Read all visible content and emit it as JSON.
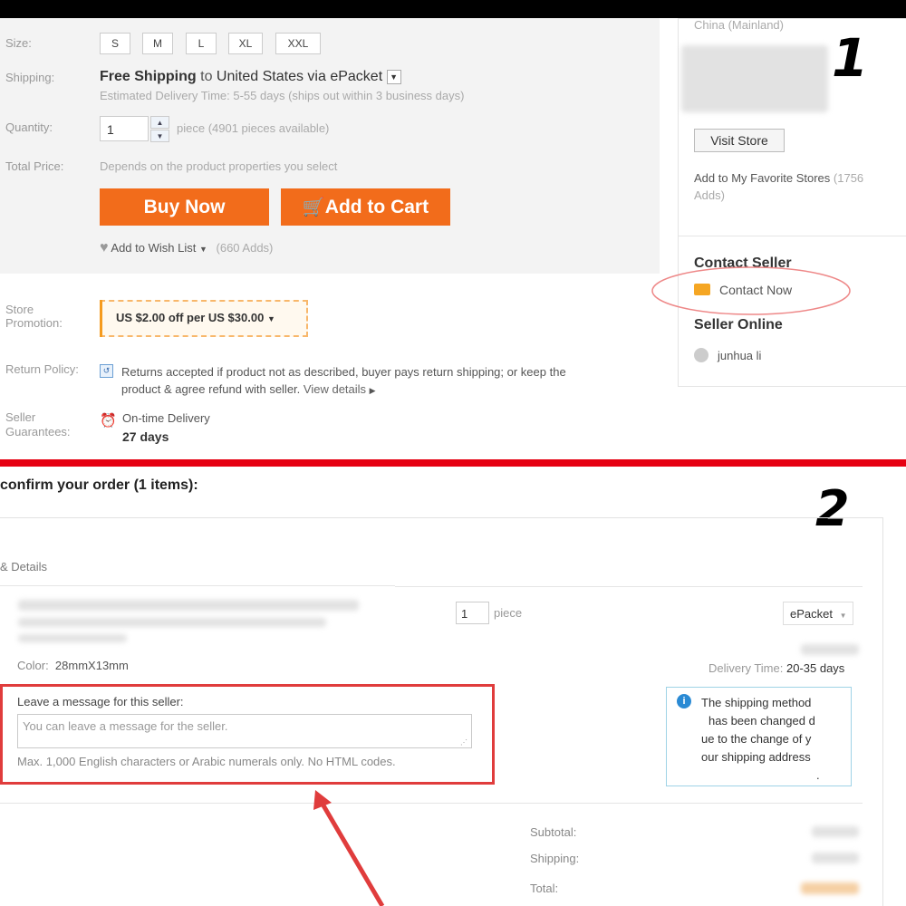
{
  "panel1": {
    "step_number": "1",
    "size": {
      "label": "Size:",
      "options": [
        "S",
        "M",
        "L",
        "XL",
        "XXL"
      ]
    },
    "shipping": {
      "label": "Shipping:",
      "free_text": "Free Shipping",
      "to_text": "to",
      "destination": "United States via ePacket",
      "estimate": "Estimated Delivery Time: 5-55 days (ships out within 3 business days)"
    },
    "quantity": {
      "label": "Quantity:",
      "value": "1",
      "available": "piece (4901 pieces available)"
    },
    "total": {
      "label": "Total Price:",
      "value": "Depends on the product properties you select"
    },
    "buy_now": "Buy Now",
    "add_to_cart": "Add to Cart",
    "wishlist": {
      "label": "Add to Wish List",
      "count": "(660 Adds)"
    },
    "store_promotion": {
      "label_line1": "Store",
      "label_line2": "Promotion:",
      "value": "US $2.00 off per US $30.00"
    },
    "return_policy": {
      "label": "Return Policy:",
      "line1": "Returns accepted if product not as described, buyer pays return shipping; or keep the",
      "line2": "product & agree refund with seller.",
      "link": "View details"
    },
    "seller_guarantees": {
      "label_line1": "Seller",
      "label_line2": "Guarantees:",
      "value": "On-time Delivery",
      "days": "27 days"
    },
    "sidebar": {
      "location": "China (Mainland)",
      "visit_store": "Visit Store",
      "favorite_line1": "Add to My Favorite Stores",
      "favorite_count": "(1756",
      "favorite_line2": "Adds)",
      "contact_heading": "Contact Seller",
      "contact_now": "Contact Now",
      "seller_online": "Seller Online",
      "seller_name": "junhua li"
    }
  },
  "panel2": {
    "step_number": "2",
    "heading": "confirm your order (1 items):",
    "section_label": "& Details",
    "quantity": {
      "value": "1",
      "unit": "piece"
    },
    "shipping_method": "ePacket",
    "color_label": "Color:",
    "color_value": "28mmX13mm",
    "delivery_label": "Delivery Time:",
    "delivery_value": "20-35 days",
    "message": {
      "label": "Leave a message for this seller:",
      "placeholder": "You can leave a message for the seller.",
      "hint": "Max. 1,000 English characters or Arabic numerals only. No HTML codes."
    },
    "info_lines": [
      "The shipping method",
      "has been changed d",
      "ue to the change of y",
      "our shipping address",
      "."
    ],
    "totals": {
      "subtotal": "Subtotal:",
      "shipping": "Shipping:",
      "total": "Total:"
    }
  },
  "colors": {
    "accent": "#f26c1b",
    "divider": "#e60012",
    "annotation": "#e03c3c"
  }
}
